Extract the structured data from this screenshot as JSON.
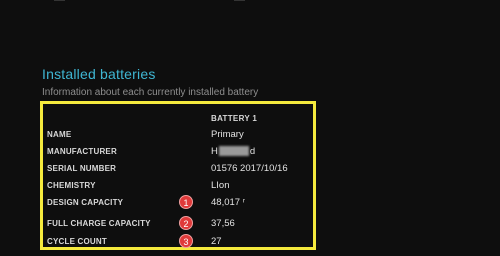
{
  "section": {
    "title": "Installed batteries",
    "subtitle": "Information about each currently installed battery"
  },
  "table": {
    "column_header": "BATTERY 1",
    "rows": [
      {
        "label": "NAME",
        "value": "Primary"
      },
      {
        "label": "MANUFACTURER",
        "value_prefix": "H",
        "value_suffix": "d"
      },
      {
        "label": "SERIAL NUMBER",
        "value": "01576 2017/10/16"
      },
      {
        "label": "CHEMISTRY",
        "value": "LIon"
      },
      {
        "label": "DESIGN CAPACITY",
        "value": "48,017 ʳ",
        "badge": "1"
      },
      {
        "label": "FULL CHARGE CAPACITY",
        "value": "37,56",
        "badge": "2"
      },
      {
        "label": "CYCLE COUNT",
        "value": "27",
        "badge": "3"
      }
    ]
  },
  "colors": {
    "title": "#3fb6d3",
    "highlight": "#f5ea3d",
    "badge": "#e03a3a",
    "background": "#0e0e0e"
  }
}
